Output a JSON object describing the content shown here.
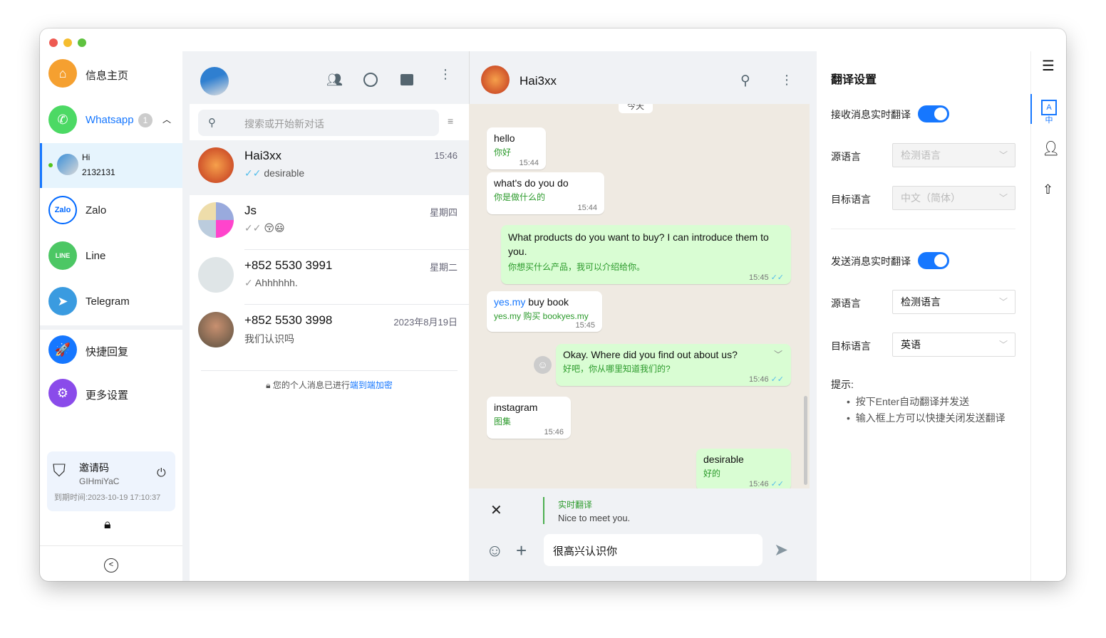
{
  "window": {
    "controls": [
      "close",
      "minimize",
      "maximize"
    ]
  },
  "sidebar": {
    "home": {
      "label": "信息主页",
      "icon": "home-icon",
      "color": "#f5a030"
    },
    "whatsapp": {
      "label": "Whatsapp",
      "badge": "1",
      "icon": "whatsapp-icon",
      "color": "#4cd964"
    },
    "account": {
      "name": "Hi",
      "id": "2132131",
      "status_color": "#52c41a"
    },
    "items": [
      {
        "label": "Zalo",
        "icon": "zalo-icon"
      },
      {
        "label": "Line",
        "icon": "line-icon"
      },
      {
        "label": "Telegram",
        "icon": "telegram-icon"
      }
    ],
    "quick_reply": {
      "label": "快捷回复",
      "icon": "rocket-icon"
    },
    "more_settings": {
      "label": "更多设置",
      "icon": "gear-icon"
    },
    "invite": {
      "title": "邀请码",
      "code": "GIHmiYaC",
      "expiry": "到期时间:2023-10-19 17:10:37"
    }
  },
  "chat_list": {
    "search_placeholder": "搜索或开始新对话",
    "chats": [
      {
        "name": "Hai3xx",
        "time": "15:46",
        "preview": "desirable",
        "tick": "✓✓"
      },
      {
        "name": "Js",
        "time": "星期四",
        "preview": "😚😃",
        "tick": "✓✓"
      },
      {
        "name": "+852 5530 3991",
        "time": "星期二",
        "preview": "Ahhhhhh.",
        "tick": "✓"
      },
      {
        "name": "+852 5530 3998",
        "time": "2023年8月19日",
        "preview": "我们认识吗",
        "tick": ""
      }
    ],
    "encryption_text": "您的个人消息已进行",
    "encryption_link": "端到端加密"
  },
  "chat": {
    "contact": "Hai3xx",
    "date_divider": "今天",
    "messages": [
      {
        "dir": "in",
        "text": "hello",
        "translation": "你好",
        "time": "15:44"
      },
      {
        "dir": "in",
        "text": "what's do you do",
        "translation": "你是做什么的",
        "time": "15:44"
      },
      {
        "dir": "out",
        "text": "What products do you want to buy? I can introduce them to you.",
        "translation": "你想买什么产品，我可以介绍给你。",
        "time": "15:45"
      },
      {
        "dir": "in",
        "link": "yes.my",
        "text": " buy book",
        "translation": "yes.my 购买 bookyes.my",
        "time": "15:45"
      },
      {
        "dir": "out",
        "text": "Okay. Where did you find out about us?",
        "translation": "好吧，你从哪里知道我们的?",
        "time": "15:46"
      },
      {
        "dir": "in",
        "text": "instagram",
        "translation": "图集",
        "time": "15:46"
      },
      {
        "dir": "out",
        "text": "desirable",
        "translation": "好的",
        "time": "15:46"
      }
    ],
    "translate_preview": {
      "label": "实时翻译",
      "text": "Nice to meet you."
    },
    "input_value": "很高兴认识你"
  },
  "settings": {
    "title": "翻译设置",
    "receive": {
      "label": "接收消息实时翻译",
      "enabled": true,
      "source_label": "源语言",
      "source": "检测语言",
      "target_label": "目标语言",
      "target": "中文（简体）"
    },
    "send": {
      "label": "发送消息实时翻译",
      "enabled": true,
      "source_label": "源语言",
      "source": "检测语言",
      "target_label": "目标语言",
      "target": "英语"
    },
    "tips_title": "提示:",
    "tips": [
      "按下Enter自动翻译并发送",
      "输入框上方可以快捷关闭发送翻译"
    ]
  },
  "colors": {
    "accent": "#1677ff",
    "outgoing_bubble": "#d9fdd3",
    "chat_bg": "#efeae2",
    "translation": "#2b9a2b"
  }
}
